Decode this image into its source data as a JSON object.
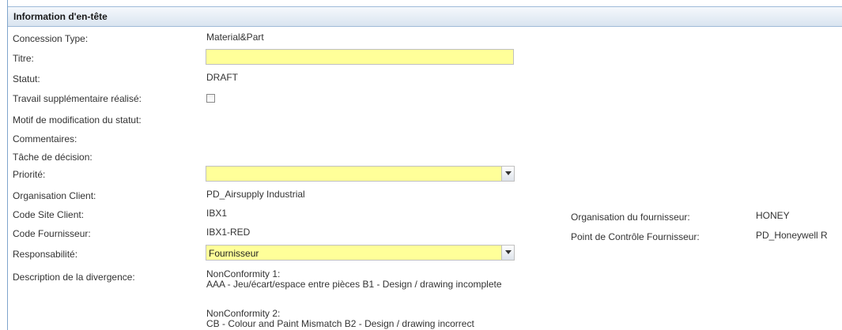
{
  "section": {
    "title": "Information d'en-tête"
  },
  "fields": {
    "concession_type": {
      "label": "Concession Type:",
      "value": "Material&Part"
    },
    "titre": {
      "label": "Titre:",
      "value": ""
    },
    "statut": {
      "label": "Statut:",
      "value": "DRAFT"
    },
    "travail_supp": {
      "label": "Travail supplémentaire réalisé:",
      "checked": false
    },
    "motif": {
      "label": "Motif de modification du statut:"
    },
    "commentaires": {
      "label": "Commentaires:"
    },
    "tache": {
      "label": "Tâche de décision:"
    },
    "priorite": {
      "label": "Priorité:",
      "value": ""
    },
    "org_client": {
      "label": "Organisation Client:",
      "value": "PD_Airsupply Industrial"
    },
    "code_site_client": {
      "label": "Code Site Client:",
      "value": "IBX1"
    },
    "code_fournisseur": {
      "label": "Code Fournisseur:",
      "value": "IBX1-RED"
    },
    "responsabilite": {
      "label": "Responsabilité:",
      "value": "Fournisseur"
    },
    "description": {
      "label": "Description de la divergence:",
      "items": [
        {
          "title": "NonConformity 1:",
          "text": "AAA - Jeu/écart/espace entre pièces B1 - Design / drawing incomplete"
        },
        {
          "title": "NonConformity 2:",
          "text": "CB - Colour and Paint Mismatch B2 - Design / drawing incorrect"
        }
      ]
    },
    "org_fournisseur": {
      "label": "Organisation du fournisseur:",
      "value": "HONEY"
    },
    "point_controle": {
      "label": "Point de Contrôle Fournisseur:",
      "value": "PD_Honeywell R"
    }
  },
  "colors": {
    "required_field": "#ffff99",
    "header_border": "#9fbad8"
  }
}
